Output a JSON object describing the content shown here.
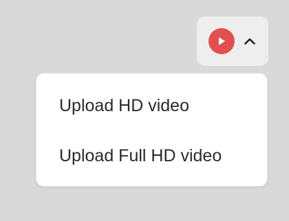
{
  "trigger": {
    "play_icon": "play-icon",
    "chevron_icon": "chevron-up-icon"
  },
  "colors": {
    "page_background": "#d9d9d9",
    "trigger_background": "#eeeeee",
    "accent_red": "#e0504f",
    "menu_background": "#ffffff",
    "menu_text": "#2a2a2a"
  },
  "menu": {
    "items": [
      {
        "label": "Upload HD video"
      },
      {
        "label": "Upload Full HD video"
      }
    ]
  }
}
